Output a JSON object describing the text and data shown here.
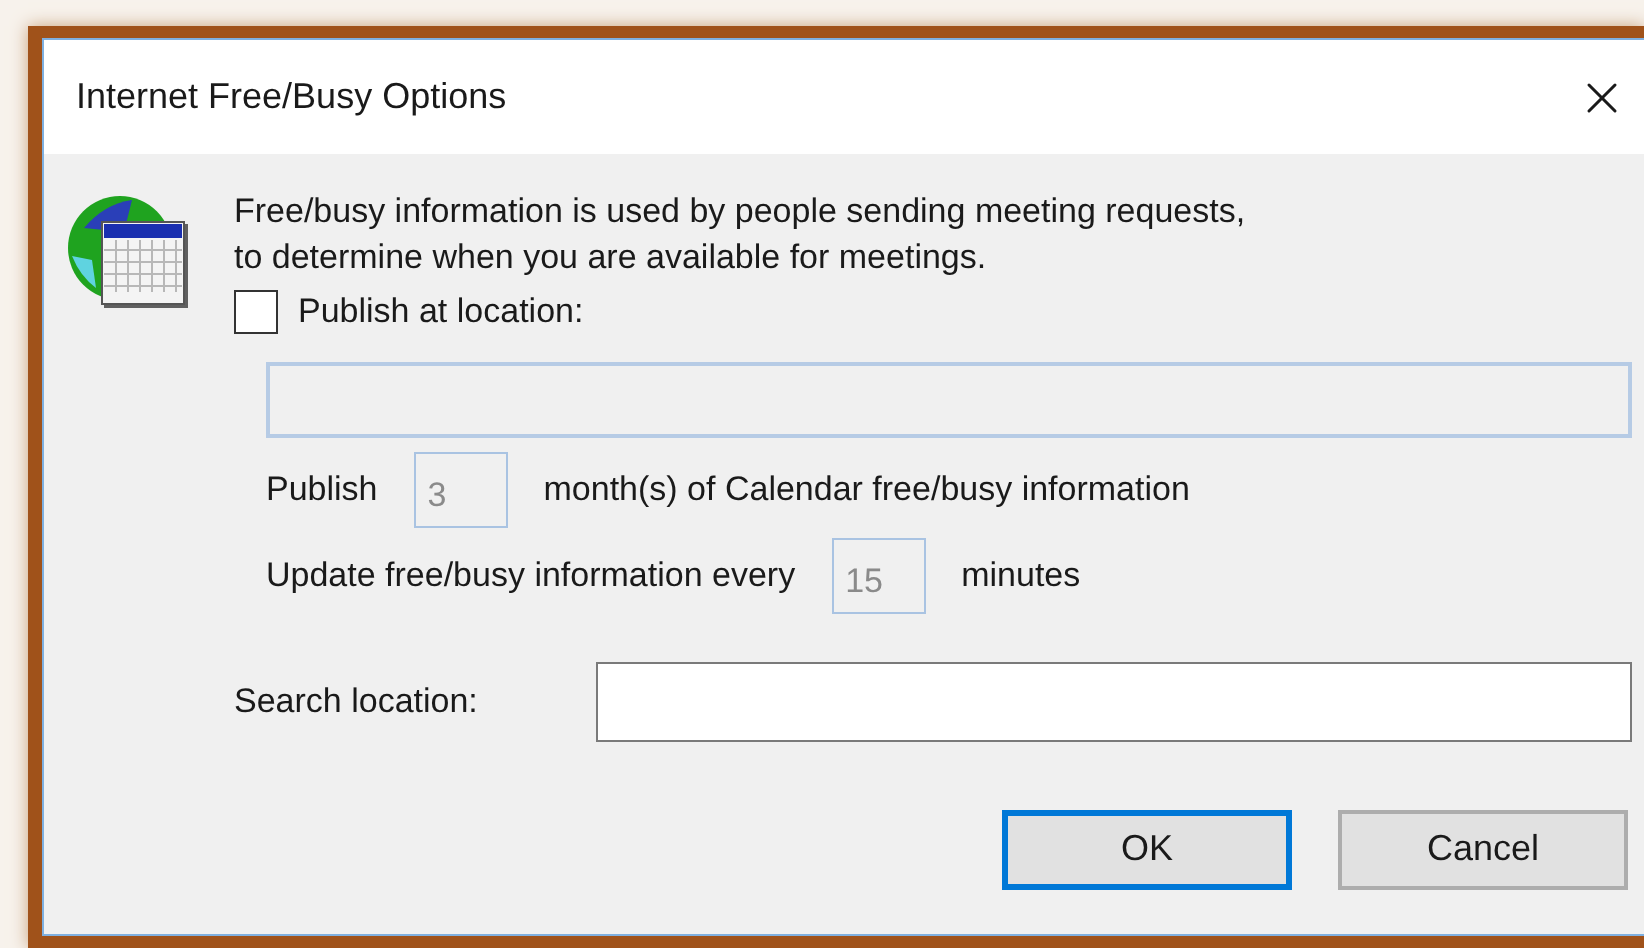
{
  "window": {
    "title": "Internet Free/Busy Options"
  },
  "message_lines": [
    "Free/busy information is used by people sending meeting requests,",
    "to determine when you are available for meetings."
  ],
  "publish_checkbox": {
    "label": "Publish at location:",
    "checked": false
  },
  "location_field": {
    "disabled": true
  },
  "publish_months": {
    "prefix": "Publish",
    "value": "3",
    "suffix": "month(s) of Calendar free/busy information",
    "disabled": true
  },
  "update_interval": {
    "prefix": "Update free/busy information every",
    "value": "15",
    "suffix": "minutes",
    "disabled": true
  },
  "search_location": {
    "label": "Search location:"
  },
  "buttons": [
    {
      "label": "OK",
      "default": true
    },
    {
      "label": "Cancel",
      "default": false
    }
  ]
}
